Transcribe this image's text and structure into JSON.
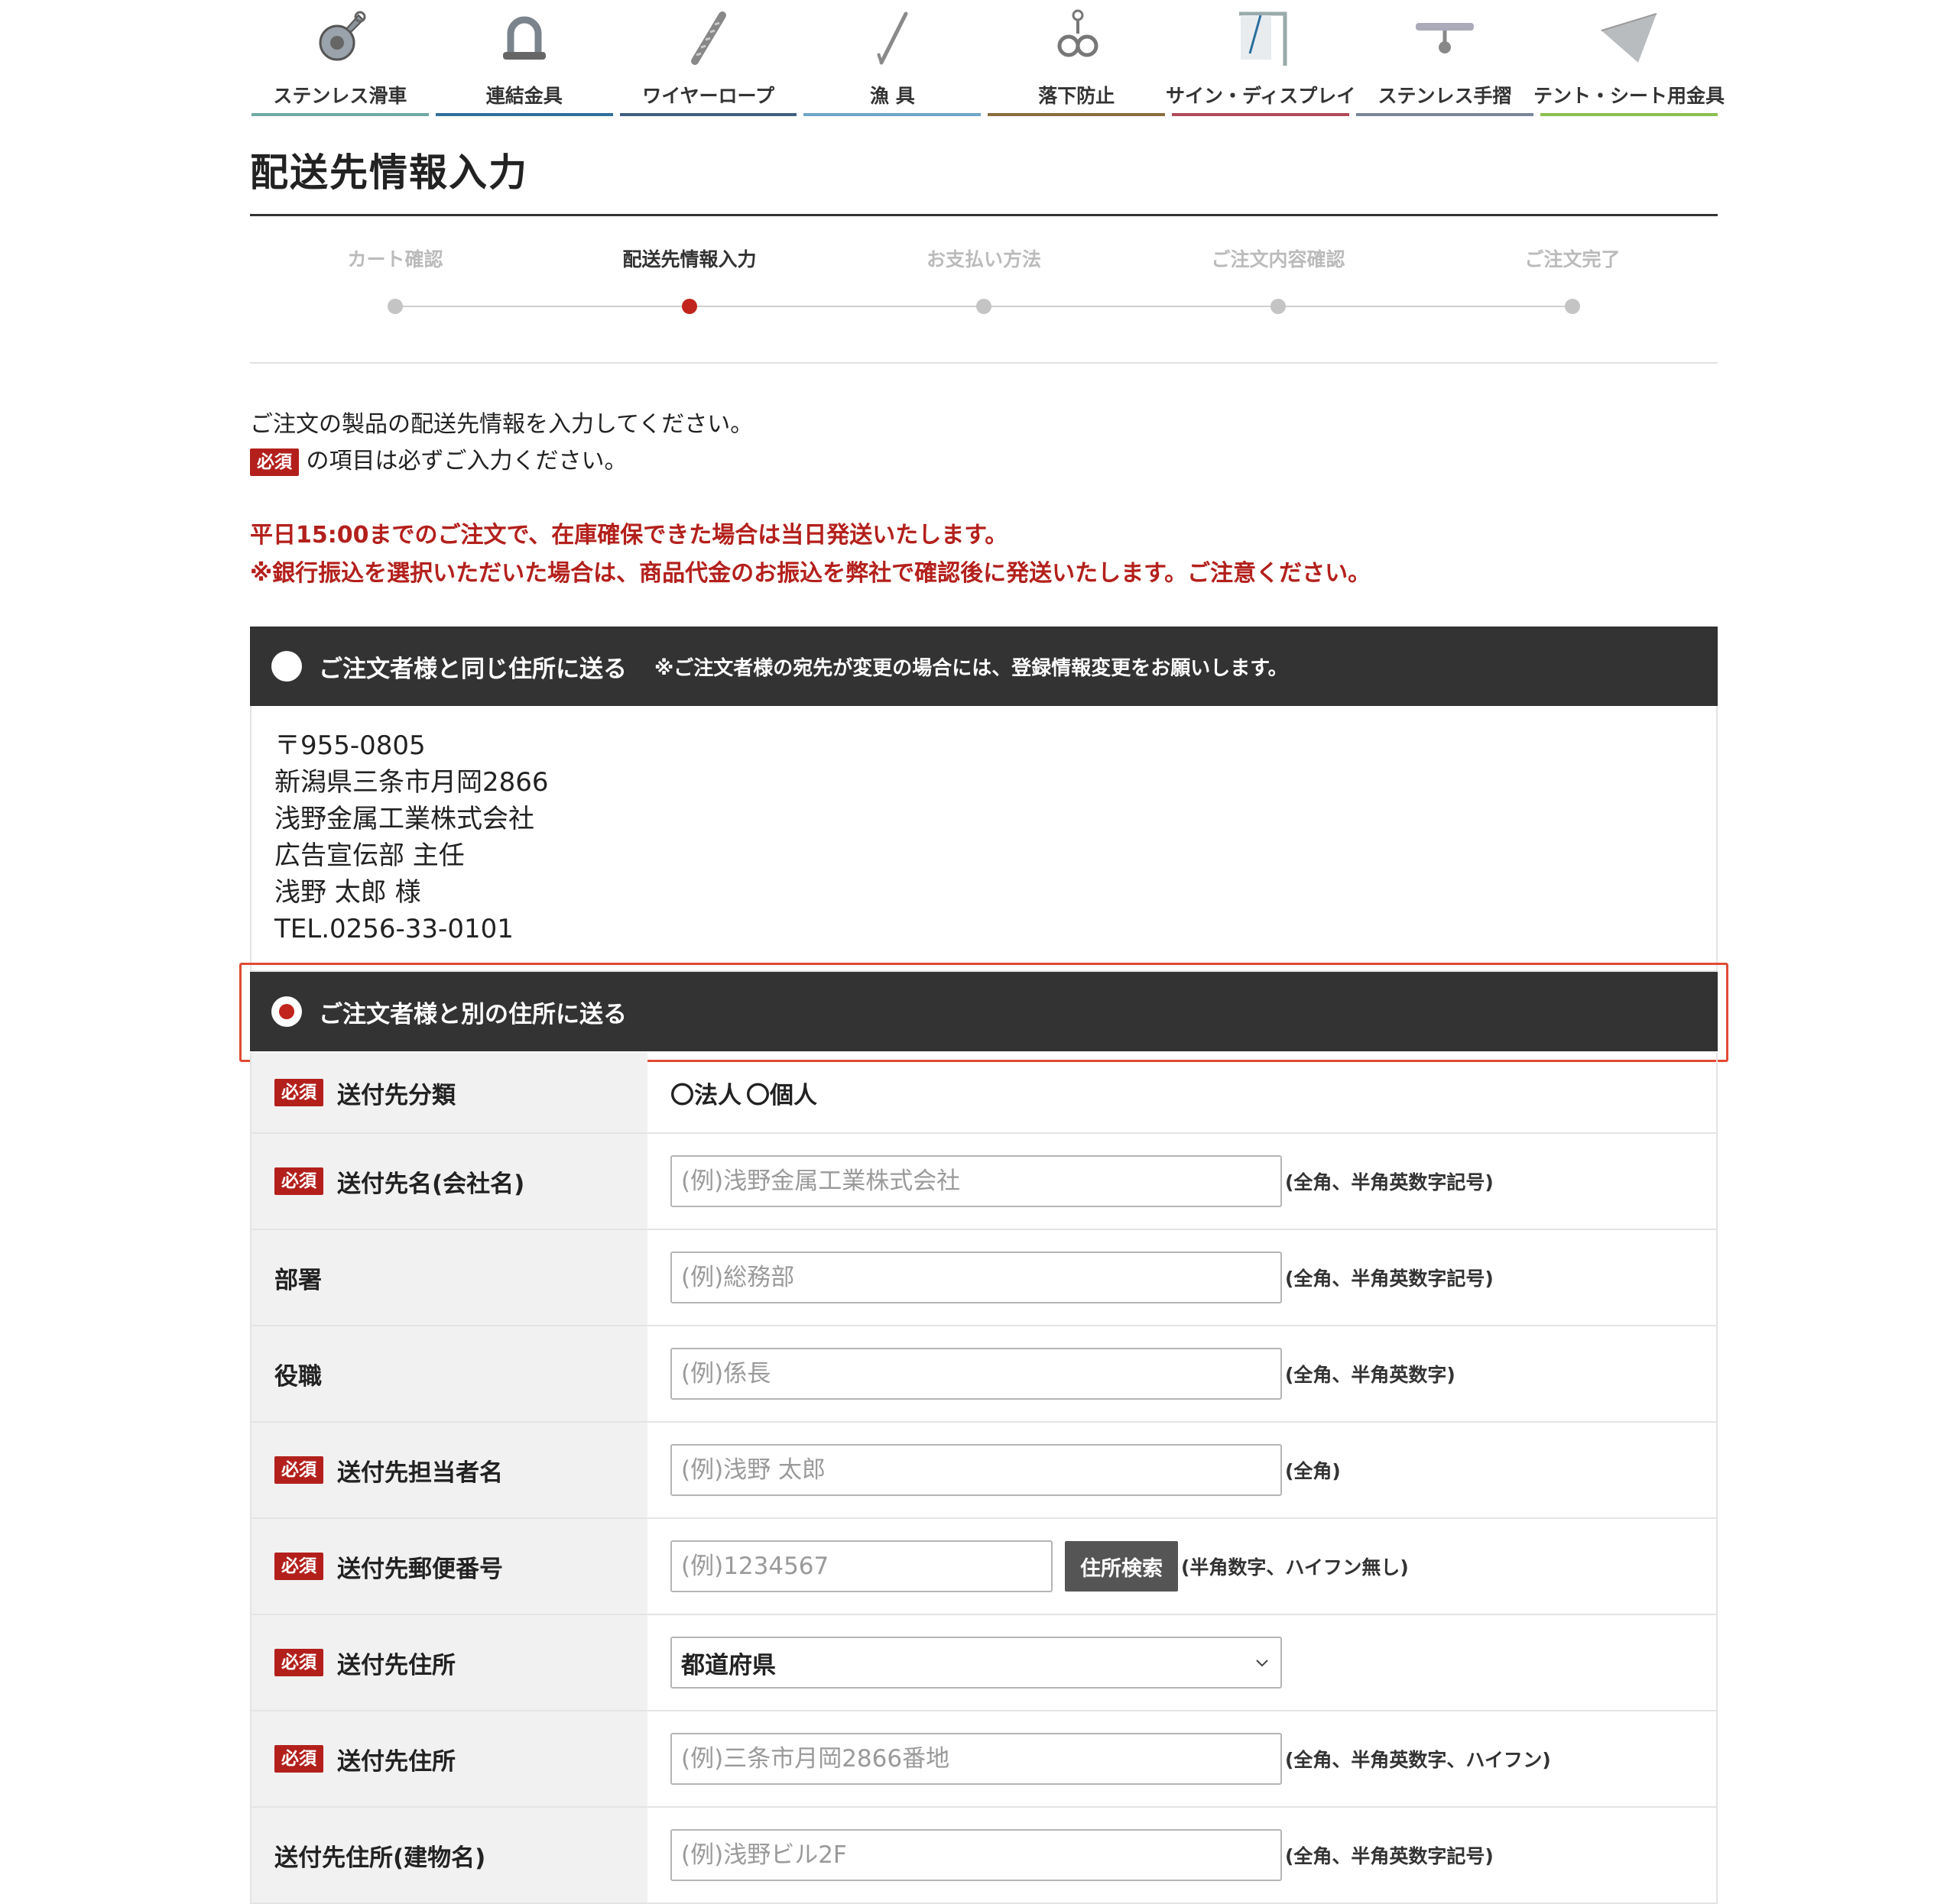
{
  "categories": [
    {
      "label": "ステンレス滑車",
      "icon": "pulley-icon",
      "color": "#6fa8a2"
    },
    {
      "label": "連結金具",
      "icon": "shackle-icon",
      "color": "#2e6f9c"
    },
    {
      "label": "ワイヤーロープ",
      "icon": "wire-rope-icon",
      "color": "#3f5f7f"
    },
    {
      "label": "漁 具",
      "icon": "fishing-hook-icon",
      "color": "#6fa6c8"
    },
    {
      "label": "落下防止",
      "icon": "fall-arrest-icon",
      "color": "#8a6d3b"
    },
    {
      "label": "サイン・ディスプレイ",
      "icon": "sign-display-icon",
      "color": "#b04a5a"
    },
    {
      "label": "ステンレス手摺",
      "icon": "handrail-icon",
      "color": "#7a8699"
    },
    {
      "label": "テント・シート用金具",
      "icon": "tent-fitting-icon",
      "color": "#8bbf4f"
    }
  ],
  "page_title": "配送先情報入力",
  "steps": [
    {
      "label": "カート確認",
      "active": false
    },
    {
      "label": "配送先情報入力",
      "active": true
    },
    {
      "label": "お支払い方法",
      "active": false
    },
    {
      "label": "ご注文内容確認",
      "active": false
    },
    {
      "label": "ご注文完了",
      "active": false
    }
  ],
  "intro": {
    "line1": "ご注文の製品の配送先情報を入力してください。",
    "required_badge": "必須",
    "line2": "の項目は必ずご入力ください。"
  },
  "notice": {
    "line1": "平日15:00までのご注文で、在庫確保できた場合は当日発送いたします。",
    "line2": "※銀行振込を選択いただいた場合は、商品代金のお振込を弊社で確認後に発送いたします。ご注意ください。"
  },
  "option_same": {
    "label": "ご注文者様と同じ住所に送る",
    "note": "※ご注文者様の宛先が変更の場合には、登録情報変更をお願いします。",
    "checked": false,
    "address": [
      "〒955-0805",
      "新潟県三条市月岡2866",
      "浅野金属工業株式会社",
      "広告宣伝部 主任",
      "浅野 太郎 様",
      "TEL.0256-33-0101"
    ]
  },
  "option_other": {
    "label": "ご注文者様と別の住所に送る",
    "checked": true
  },
  "form": {
    "badge": "必須",
    "dest_type": {
      "label": "送付先分類",
      "options": [
        "〇法人",
        "〇個人"
      ]
    },
    "company": {
      "label": "送付先名(会社名)",
      "placeholder": "(例)浅野金属工業株式会社",
      "hint": "(全角、半角英数字記号)"
    },
    "department": {
      "label": "部署",
      "placeholder": "(例)総務部",
      "hint": "(全角、半角英数字記号)"
    },
    "position": {
      "label": "役職",
      "placeholder": "(例)係長",
      "hint": "(全角、半角英数字)"
    },
    "contact": {
      "label": "送付先担当者名",
      "placeholder": "(例)浅野 太郎",
      "hint": "(全角)"
    },
    "zip": {
      "label": "送付先郵便番号",
      "placeholder": "(例)1234567",
      "button": "住所検索",
      "hint": "(半角数字、ハイフン無し)"
    },
    "prefecture": {
      "label": "送付先住所",
      "selected": "都道府県"
    },
    "address": {
      "label": "送付先住所",
      "placeholder": "(例)三条市月岡2866番地",
      "hint": "(全角、半角英数字、ハイフン)"
    },
    "building": {
      "label": "送付先住所(建物名)",
      "placeholder": "(例)浅野ビル2F",
      "hint": "(全角、半角英数字記号)"
    }
  }
}
